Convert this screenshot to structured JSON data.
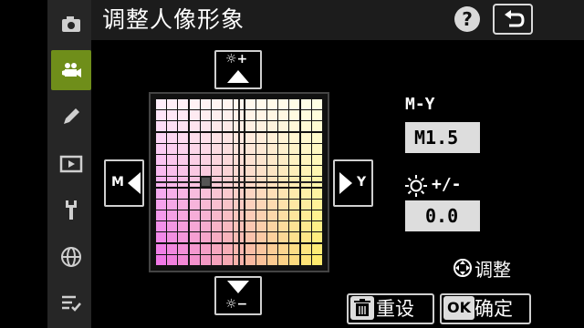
{
  "header": {
    "title": "调整人像形象",
    "help_label": "?"
  },
  "sidebar": {
    "items": [
      {
        "icon": "camera-icon"
      },
      {
        "icon": "movie-camera-icon",
        "active": true
      },
      {
        "icon": "pencil-icon"
      },
      {
        "icon": "playback-icon"
      },
      {
        "icon": "wrench-icon"
      },
      {
        "icon": "network-icon"
      },
      {
        "icon": "my-menu-icon"
      }
    ]
  },
  "grid": {
    "up_label": "☼+",
    "down_label": "☼−",
    "left_label": "M",
    "right_label": "Y",
    "selected_m_y": -1.5,
    "selected_brightness": 0.0
  },
  "panel": {
    "hue_label": "M-Y",
    "hue_value": "M1.5",
    "brightness_label": "+/-",
    "brightness_value": "0.0",
    "adjust_hint": "调整"
  },
  "footer": {
    "reset_label": "重设",
    "ok_key": "OK",
    "confirm_label": "确定"
  }
}
